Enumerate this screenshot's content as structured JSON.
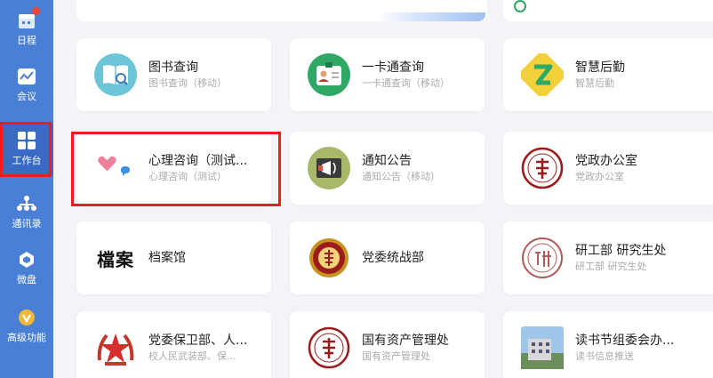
{
  "sidebar": {
    "items": [
      {
        "label": "日程",
        "icon": "calendar-icon",
        "badge": true
      },
      {
        "label": "会议",
        "icon": "meeting-icon"
      },
      {
        "label": "工作台",
        "icon": "grid-icon",
        "active": true
      },
      {
        "label": "通讯录",
        "icon": "org-chart-icon"
      },
      {
        "label": "微盘",
        "icon": "cloud-disk-icon"
      },
      {
        "label": "高级功能",
        "icon": "premium-icon"
      }
    ]
  },
  "top_notice": "…………",
  "apps": [
    {
      "title": "图书查询",
      "subtitle": "图书查询（移动）",
      "icon": "book-search-icon"
    },
    {
      "title": "一卡通查询",
      "subtitle": "一卡通查询（移动）",
      "icon": "id-card-icon"
    },
    {
      "title": "智慧后勤",
      "subtitle": "智慧后勤",
      "icon": "z-logo-icon"
    },
    {
      "title": "心理咨询（测试...",
      "subtitle": "心理咨询（测试）",
      "icon": "hearts-chat-icon",
      "highlighted": true
    },
    {
      "title": "通知公告",
      "subtitle": "通知公告（移动）",
      "icon": "megaphone-icon"
    },
    {
      "title": "党政办公室",
      "subtitle": "党政办公室",
      "icon": "seal-icon"
    },
    {
      "title": "档案馆",
      "subtitle": "",
      "icon": "archive-calligraphy-icon"
    },
    {
      "title": "党委统战部",
      "subtitle": "",
      "icon": "seal-icon"
    },
    {
      "title": "研工部 研究生处",
      "subtitle": "研工部 研究生处",
      "icon": "grad-seal-icon"
    },
    {
      "title": "党委保卫部、人...",
      "subtitle": "校人民武装部、保...",
      "icon": "star-emblem-icon"
    },
    {
      "title": "国有资产管理处",
      "subtitle": "国有资产管理处",
      "icon": "seal-icon"
    },
    {
      "title": "读书节组委会办...",
      "subtitle": "读书信息推送",
      "icon": "building-photo-icon"
    }
  ],
  "archive_logo_text": "檔案",
  "colors": {
    "sidebar": "#4a7fd6",
    "highlight": "#ee1c1c",
    "seal": "#9b1c1c"
  }
}
